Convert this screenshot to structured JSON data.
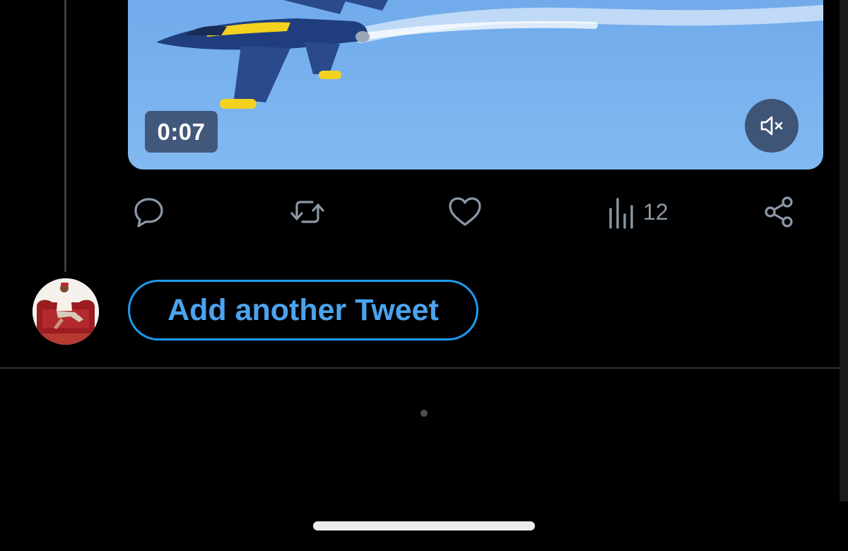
{
  "video": {
    "duration": "0:07",
    "mute_icon": "speaker-muted-icon"
  },
  "actions": {
    "reply_icon": "reply-bubble-icon",
    "retweet_icon": "retweet-icon",
    "like_icon": "heart-icon",
    "views_icon": "views-bar-chart-icon",
    "views_count": "12",
    "share_icon": "share-icon"
  },
  "composer": {
    "avatar": "user-avatar",
    "add_button_label": "Add another Tweet"
  },
  "colors": {
    "background": "#000000",
    "accent": "#1d9bf0",
    "icon_gray": "#8b98a5",
    "divider": "#2f3336"
  }
}
